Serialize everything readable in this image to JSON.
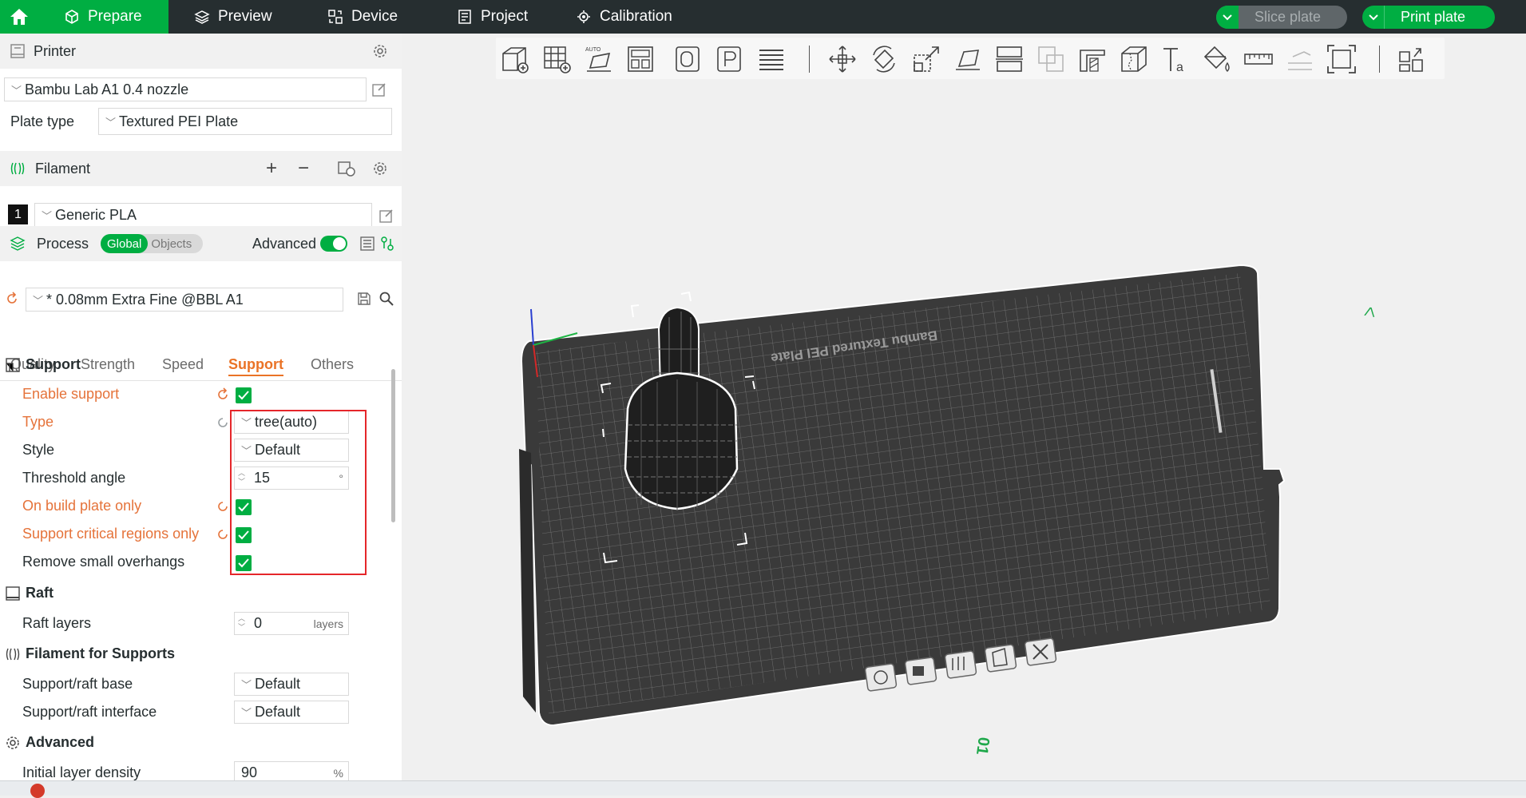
{
  "topbar": {
    "tabs": [
      {
        "label": "Prepare",
        "icon": "cube-icon",
        "active": true
      },
      {
        "label": "Preview",
        "icon": "layers-icon",
        "active": false
      },
      {
        "label": "Device",
        "icon": "device-icon",
        "active": false
      },
      {
        "label": "Project",
        "icon": "project-icon",
        "active": false
      },
      {
        "label": "Calibration",
        "icon": "calibration-icon",
        "active": false
      }
    ],
    "slice_label": "Slice plate",
    "print_label": "Print plate",
    "accent": "#00ae42"
  },
  "printer": {
    "header": "Printer",
    "selected": "Bambu Lab A1 0.4 nozzle",
    "plate_type_label": "Plate type",
    "plate_type": "Textured PEI Plate"
  },
  "filament": {
    "header": "Filament",
    "slot": "1",
    "selected": "Generic PLA"
  },
  "process": {
    "header": "Process",
    "scope_global": "Global",
    "scope_objects": "Objects",
    "advanced_label": "Advanced",
    "advanced_on": true,
    "preset": "* 0.08mm Extra Fine @BBL A1",
    "tabs": [
      "Quality",
      "Strength",
      "Speed",
      "Support",
      "Others"
    ],
    "active_tab": "Support"
  },
  "support": {
    "group": "Support",
    "enable_support": "Enable support",
    "type_label": "Type",
    "type_value": "tree(auto)",
    "style_label": "Style",
    "style_value": "Default",
    "threshold_label": "Threshold angle",
    "threshold_value": "15",
    "threshold_unit": "°",
    "build_plate_only": "On build plate only",
    "critical_only": "Support critical regions only",
    "remove_small": "Remove small overhangs"
  },
  "raft": {
    "group": "Raft",
    "layers_label": "Raft layers",
    "layers_value": "0",
    "layers_unit": "layers"
  },
  "filament_supports": {
    "group": "Filament for Supports",
    "base_label": "Support/raft base",
    "base_value": "Default",
    "interface_label": "Support/raft interface",
    "interface_value": "Default"
  },
  "advanced": {
    "group": "Advanced",
    "density_label": "Initial layer density",
    "density_value": "90",
    "density_unit": "%"
  },
  "plate": {
    "label": "Bambu Textured PEI Plate",
    "number": "01"
  },
  "highlight_color": "#e5262a"
}
